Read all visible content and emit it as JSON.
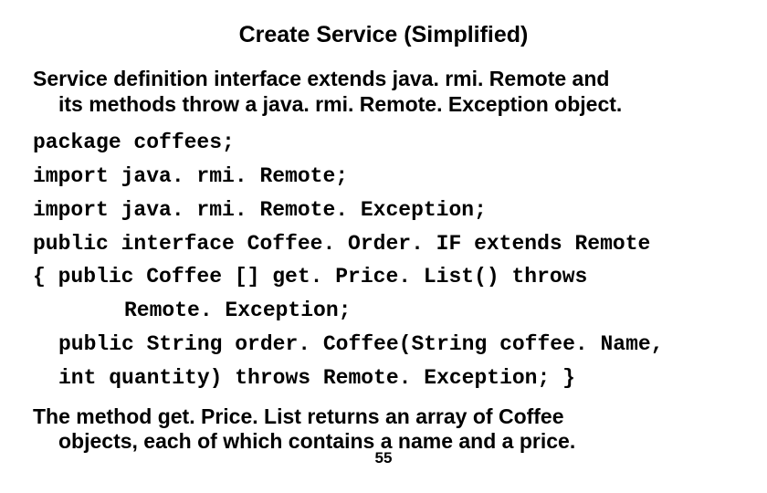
{
  "title": "Create Service (Simplified)",
  "intro": {
    "line1": "Service definition interface extends java. rmi. Remote and",
    "line2": "its methods throw a java. rmi. Remote. Exception object."
  },
  "code": {
    "l1": "package coffees;",
    "l2": "import java. rmi. Remote;",
    "l3": "import java. rmi. Remote. Exception;",
    "l4": "public interface Coffee. Order. IF extends Remote",
    "l5": "{ public Coffee [] get. Price. List() throws",
    "l5b": "Remote. Exception;",
    "l6": "public String order. Coffee(String coffee. Name,",
    "l7": "int quantity) throws   Remote. Exception; }"
  },
  "outro": {
    "line1": "The method get. Price. List returns an array of Coffee",
    "line2": "objects, each of which contains a name and a price."
  },
  "pagenum": "55"
}
